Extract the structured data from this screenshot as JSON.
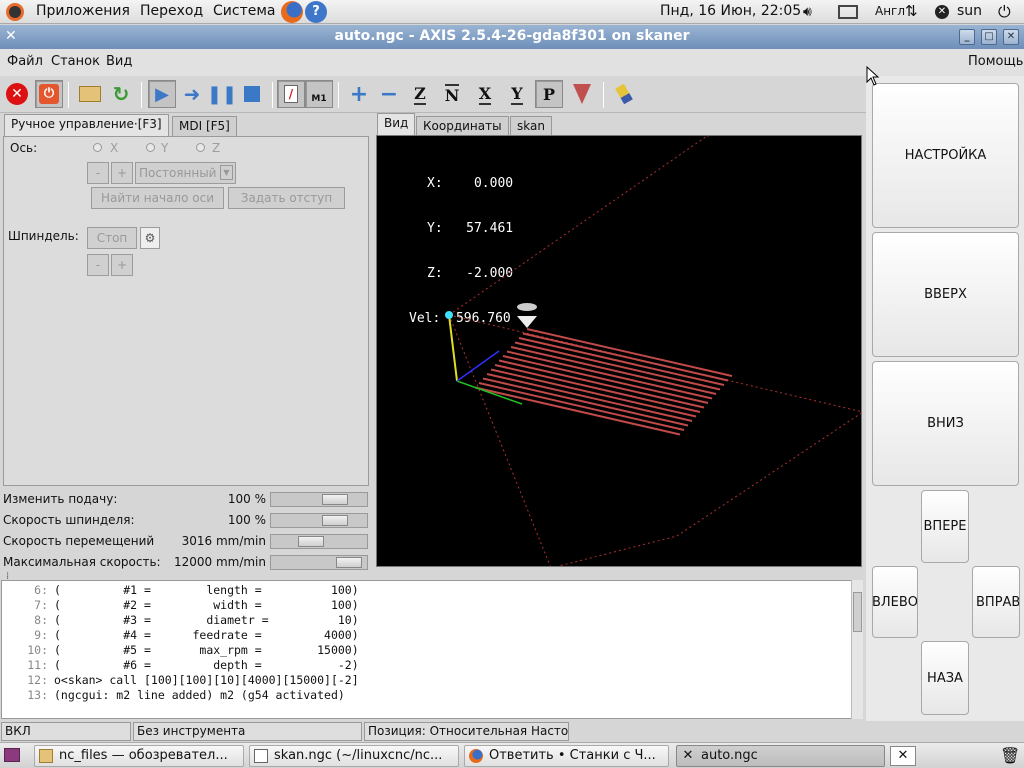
{
  "panel": {
    "apps": "Приложения",
    "places": "Переход",
    "system": "Система",
    "datetime": "Пнд, 16 Июн, 22:05",
    "keyboard": "Англ",
    "user": "sun"
  },
  "window": {
    "title": "auto.ngc - AXIS 2.5.4-26-gda8f301 on skaner"
  },
  "menu": {
    "file": "Файл",
    "machine": "Станок",
    "view": "Вид",
    "help": "Помощь"
  },
  "toolbar": {
    "m1_label": "M1",
    "z_label": "Z",
    "x_label": "X",
    "y_label": "Y",
    "p_label": "P"
  },
  "left_tabs": {
    "manual": "Ручное управление·[F3]",
    "mdi": "MDI [F5]"
  },
  "manual": {
    "axis_label": "Ось:",
    "axes": [
      "X",
      "Y",
      "Z"
    ],
    "minus": "-",
    "plus": "+",
    "jog_mode": "Постоянный",
    "home_button": "Найти начало оси",
    "offset_button": "Задать отступ",
    "spindle_label": "Шпиндель:",
    "stop_button": "Стоп"
  },
  "overrides": [
    {
      "label": "Изменить подачу:",
      "value": "100 %",
      "level": 0.75
    },
    {
      "label": "Скорость шпинделя:",
      "value": "100 %",
      "level": 0.75
    },
    {
      "label": "Скорость перемещений",
      "value": "3016 mm/min",
      "level": 0.4
    },
    {
      "label": "Максимальная скорость:",
      "value": "12000 mm/min",
      "level": 0.95
    }
  ],
  "view_tabs": {
    "preview": "Вид",
    "dro": "Координаты",
    "skan": "skan"
  },
  "dro": {
    "x": "X:    0.000",
    "y": "Y:   57.461",
    "z": "Z:   -2.000",
    "vel": "Vel:  596.760"
  },
  "gcode": [
    {
      "n": "6:",
      "text": "(         #1 =        length =          100)"
    },
    {
      "n": "7:",
      "text": "(         #2 =         width =          100)"
    },
    {
      "n": "8:",
      "text": "(         #3 =        diametr =          10)"
    },
    {
      "n": "9:",
      "text": "(         #4 =      feedrate =         4000)"
    },
    {
      "n": "10:",
      "text": "(         #5 =       max_rpm =        15000)"
    },
    {
      "n": "11:",
      "text": "(         #6 =         depth =           -2)"
    },
    {
      "n": "12:",
      "text": "o<skan> call [100][100][10][4000][15000][-2]"
    },
    {
      "n": "13:",
      "text": "(ngcgui: m2 line added) m2 (g54 activated)"
    }
  ],
  "status": {
    "state": "ВКЛ",
    "tool": "Без инструмента",
    "position": "Позиция: Относительная Насто"
  },
  "right_panel": {
    "setup": "НАСТРОЙКА",
    "up": "ВВЕРХ",
    "down": "ВНИЗ",
    "forward": "ВПЕРЕ",
    "left": "ВЛЕВО",
    "right": "ВПРАВ",
    "back": "НАЗА"
  },
  "taskbar": [
    {
      "label": "nc_files — обозревател...",
      "icon": "folder-icon"
    },
    {
      "label": "skan.ngc (~/linuxcnc/nc...",
      "icon": "text-editor-icon"
    },
    {
      "label": "Ответить • Станки с Ч...",
      "icon": "firefox-icon"
    },
    {
      "label": "auto.ngc",
      "icon": "axis-icon"
    }
  ],
  "colors": {
    "accent": "#7b96bd",
    "toolpath": "#c04a4a",
    "canvas": "#000000"
  }
}
